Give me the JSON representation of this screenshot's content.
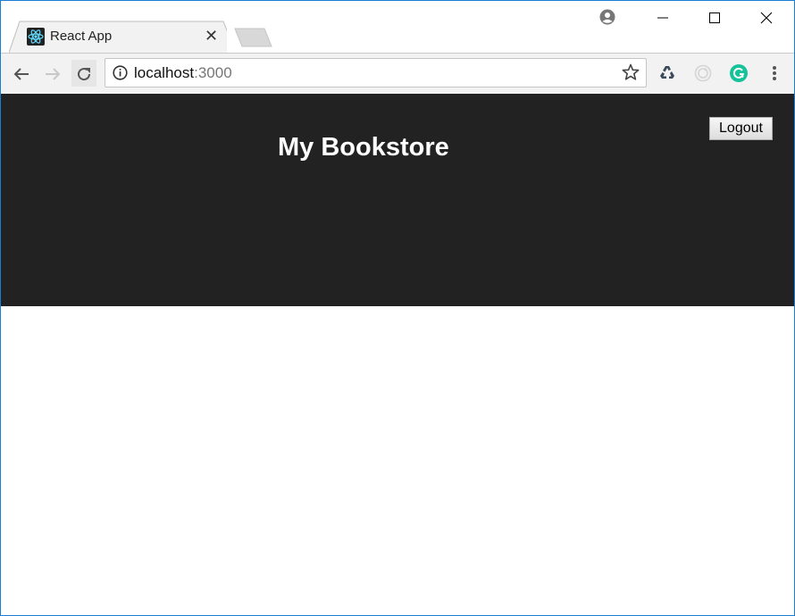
{
  "browser": {
    "tab": {
      "title": "React App",
      "favicon": "react-logo-icon",
      "close_icon": "close-icon"
    },
    "window_controls": [
      "profile-icon",
      "minimize-icon",
      "maximize-icon",
      "close-window-icon"
    ],
    "address_bar": {
      "host": "localhost",
      "port": ":3000",
      "security_icon": "info-icon"
    },
    "extensions": [
      "recycle-extension-icon",
      "disabled-extension-icon",
      "grammarly-icon",
      "menu-icon"
    ],
    "colors": {
      "grammarly": "#15c39a",
      "react": "#61dafb"
    }
  },
  "app": {
    "title": "My Bookstore",
    "logout_label": "Logout",
    "header_color": "#222222"
  }
}
